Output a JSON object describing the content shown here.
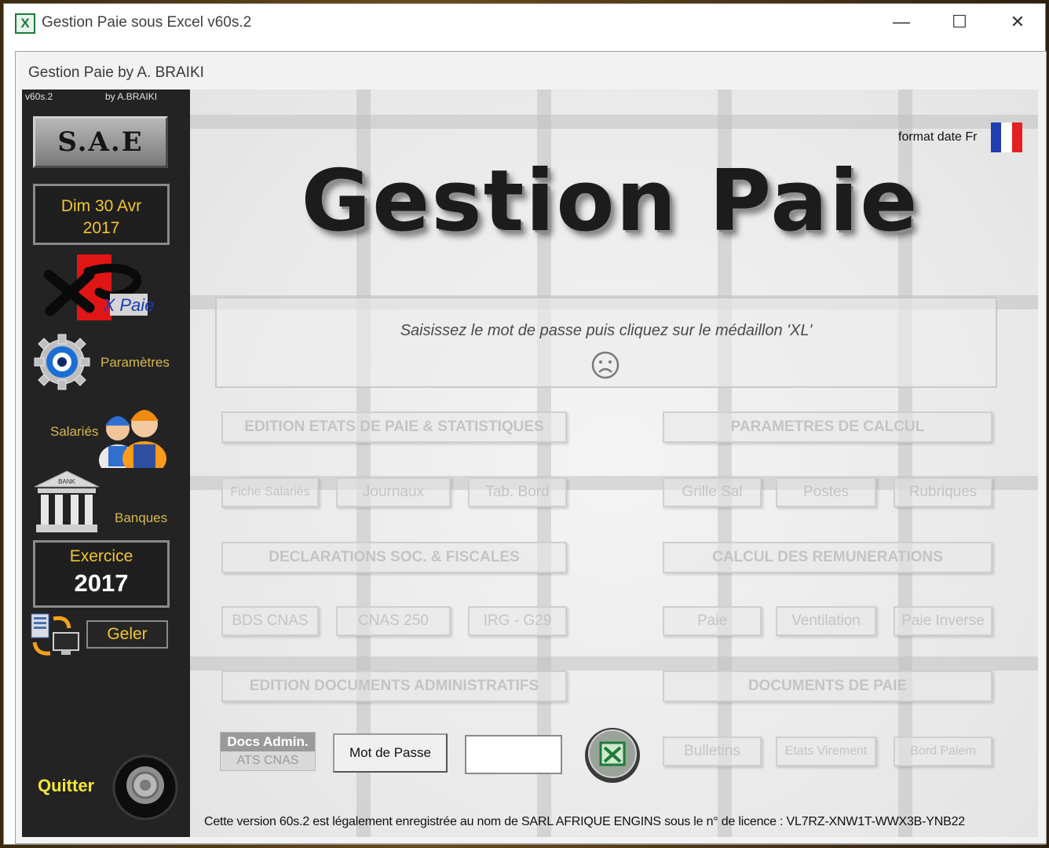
{
  "window": {
    "title": "Gestion Paie sous Excel v60s.2",
    "icon": "X"
  },
  "form": {
    "title": "Gestion Paie by A. BRAIKI"
  },
  "sidebar": {
    "version": "v60s.2",
    "author": "by  A.BRAIKI",
    "sae_label": "S.A.E",
    "date_line1": "Dim 30 Avr",
    "date_line2": "2017",
    "logo_text": "X Paie",
    "params_label": "Paramètres",
    "salaries_label": "Salariés",
    "bank_sign": "BANK",
    "banques_label": "Banques",
    "exercice_label": "Exercice",
    "exercice_year": "2017",
    "geler_label": "Geler",
    "quitter_label": "Quitter"
  },
  "main": {
    "format_label": "format date Fr",
    "title": "Gestion Paie",
    "message": "Saisissez le mot de passe puis cliquez sur le médaillon 'XL'",
    "groups": {
      "edition_etats": "EDITION ETATS DE PAIE & STATISTIQUES",
      "parametres_calcul": "PARAMETRES DE CALCUL",
      "declarations": "DECLARATIONS SOC. & FISCALES",
      "calcul_remunerations": "CALCUL DES REMUNERATIONS",
      "edition_documents": "EDITION DOCUMENTS ADMINISTRATIFS",
      "documents_paie": "DOCUMENTS DE PAIE"
    },
    "buttons": {
      "fiche_salaries": "Fiche Salariés",
      "journaux": "Journaux",
      "tab_bord": "Tab. Bord",
      "grille_sal": "Grille Sal",
      "postes": "Postes",
      "rubriques": "Rubriques",
      "bds_cnas": "BDS CNAS",
      "cnas_250": "CNAS 250",
      "irg_g29": "IRG - G29",
      "paie": "Paie",
      "ventilation": "Ventilation",
      "paie_inverse": "Paie Inverse",
      "bulletins": "Bulletins",
      "etats_virement": "Etats Virement",
      "bord_paiem": "Bord Paiem"
    },
    "docs_admin_title": "Docs Admin.",
    "docs_admin_sub": "ATS CNAS",
    "mdp_label": "Mot de Passe",
    "mdp_value": "",
    "licence": "Cette version 60s.2 est légalement enregistrée au nom de SARL AFRIQUE ENGINS sous le n° de licence : VL7RZ-XNW1T-WWX3B-YNB22"
  },
  "colors": {
    "sidebar_bg": "#232323",
    "accent_yellow": "#f2c62e",
    "label_gold": "#d6b84a",
    "ghost_text": "#c4c4c4"
  }
}
